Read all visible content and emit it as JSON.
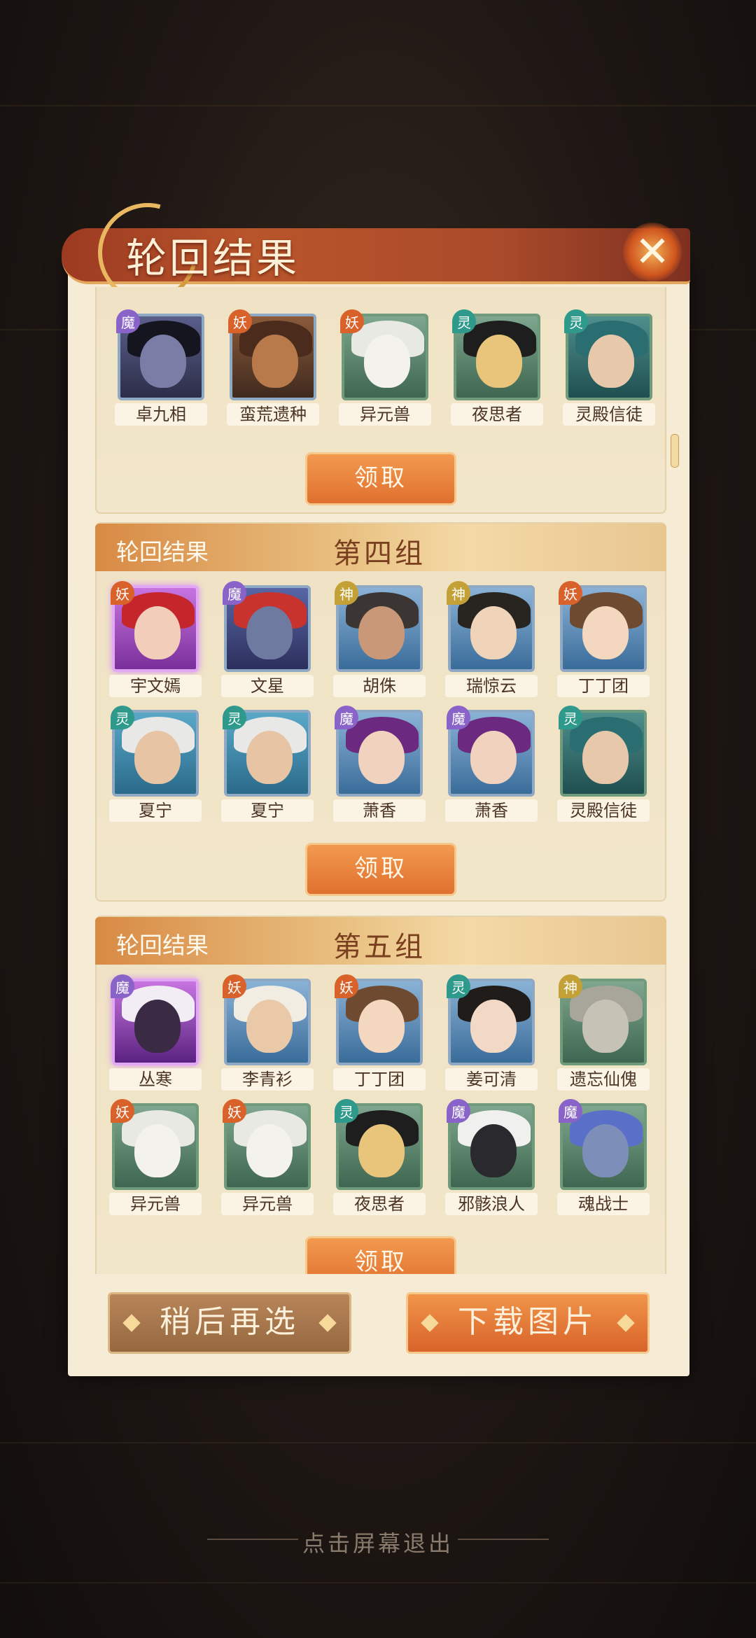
{
  "title": "轮回结果",
  "group_label": "轮回结果",
  "claim_label": "领取",
  "exit_hint": "点击屏幕退出",
  "buttons": {
    "later": "稍后再选",
    "download": "下载图片"
  },
  "badge_text": {
    "mo": "魔",
    "yao": "妖",
    "ling": "灵",
    "shen": "神"
  },
  "groups": [
    {
      "name": "",
      "rows": [
        [
          {
            "name": "卓九相",
            "faction": "魔"
          },
          {
            "name": "蛮荒遗种",
            "faction": "妖"
          },
          {
            "name": "异元兽",
            "faction": "妖"
          },
          {
            "name": "夜思者",
            "faction": "灵"
          },
          {
            "name": "灵殿信徒",
            "faction": "灵"
          }
        ]
      ]
    },
    {
      "name": "第四组",
      "rows": [
        [
          {
            "name": "宇文嫣",
            "faction": "妖"
          },
          {
            "name": "文星",
            "faction": "魔"
          },
          {
            "name": "胡侏",
            "faction": "神"
          },
          {
            "name": "瑞惊云",
            "faction": "神"
          },
          {
            "name": "丁丁团",
            "faction": "妖"
          }
        ],
        [
          {
            "name": "夏宁",
            "faction": "灵"
          },
          {
            "name": "夏宁",
            "faction": "灵"
          },
          {
            "name": "萧香",
            "faction": "魔"
          },
          {
            "name": "萧香",
            "faction": "魔"
          },
          {
            "name": "灵殿信徒",
            "faction": "灵"
          }
        ]
      ]
    },
    {
      "name": "第五组",
      "rows": [
        [
          {
            "name": "丛寒",
            "faction": "魔"
          },
          {
            "name": "李青衫",
            "faction": "妖"
          },
          {
            "name": "丁丁团",
            "faction": "妖"
          },
          {
            "name": "姜可清",
            "faction": "灵"
          },
          {
            "name": "遗忘仙傀",
            "faction": "神"
          }
        ],
        [
          {
            "name": "异元兽",
            "faction": "妖"
          },
          {
            "name": "异元兽",
            "faction": "妖"
          },
          {
            "name": "夜思者",
            "faction": "灵"
          },
          {
            "name": "邪骸浪人",
            "faction": "魔"
          },
          {
            "name": "魂战士",
            "faction": "魔"
          }
        ]
      ]
    }
  ],
  "colors": {
    "accent": "#e0702e",
    "title_bar": "#a94a2a",
    "panel": "#f6ecd6"
  }
}
